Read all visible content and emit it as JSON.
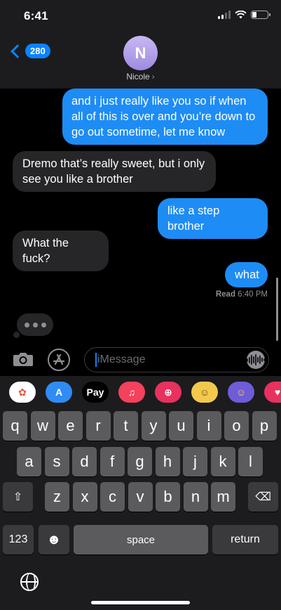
{
  "status_bar": {
    "time": "6:41"
  },
  "nav": {
    "back_count": "280",
    "contact_initial": "N",
    "contact_name": "Nicole",
    "chevron": "›"
  },
  "messages": [
    {
      "from": "me",
      "text": "and i just really like you so if when all of this is over and you’re down to go out sometime, let me know"
    },
    {
      "from": "them",
      "text": "Dremo that’s really sweet, but i only see you like a brother"
    },
    {
      "from": "me",
      "text": "like a step brother"
    },
    {
      "from": "them",
      "text": "What the fuck?"
    },
    {
      "from": "me",
      "text": "what"
    }
  ],
  "read_receipt": {
    "label": "Read",
    "time": "6:40 PM"
  },
  "compose": {
    "placeholder": "iMessage"
  },
  "app_strip": [
    {
      "name": "photos-app-icon",
      "glyph": "✿",
      "bg": "#ffffff",
      "fg": "#e8523c"
    },
    {
      "name": "app-store-icon",
      "glyph": "A",
      "bg": "#2f8cf5",
      "fg": "#ffffff"
    },
    {
      "name": "apple-pay-icon",
      "glyph": "Pay",
      "bg": "#000000",
      "fg": "#ffffff"
    },
    {
      "name": "music-app-icon",
      "glyph": "♫",
      "bg": "#f5415b",
      "fg": "#ffffff"
    },
    {
      "name": "search-images-icon",
      "glyph": "⊕",
      "bg": "#e8315e",
      "fg": "#ffffff"
    },
    {
      "name": "memoji-stickers-icon",
      "glyph": "☺",
      "bg": "#f2c94c",
      "fg": "#7a4a1f"
    },
    {
      "name": "animoji-icon",
      "glyph": "☺",
      "bg": "#6e5cd8",
      "fg": "#ffd45a"
    },
    {
      "name": "digital-touch-icon",
      "glyph": "♥",
      "bg": "#e8315e",
      "fg": "#ffffff"
    }
  ],
  "keyboard": {
    "row1": [
      "q",
      "w",
      "e",
      "r",
      "t",
      "y",
      "u",
      "i",
      "o",
      "p"
    ],
    "row2": [
      "a",
      "s",
      "d",
      "f",
      "g",
      "h",
      "j",
      "k",
      "l"
    ],
    "row3": [
      "z",
      "x",
      "c",
      "v",
      "b",
      "n",
      "m"
    ],
    "numbers_label": "123",
    "emoji_glyph": "☻",
    "space_label": "space",
    "return_label": "return",
    "shift_glyph": "⇧",
    "delete_glyph": "⌫"
  },
  "colors": {
    "sent_bubble": "#1e8cf5",
    "received_bubble": "#262628",
    "accent": "#0a84ff"
  }
}
